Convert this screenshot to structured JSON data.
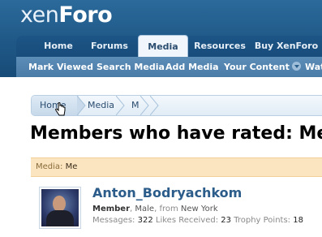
{
  "header": {
    "logo_a": "xen",
    "logo_b": "Foro"
  },
  "nav": {
    "tabs": [
      {
        "label": "Home"
      },
      {
        "label": "Forums"
      },
      {
        "label": "Media"
      },
      {
        "label": "Resources"
      },
      {
        "label": "Buy XenForo"
      }
    ],
    "selected_tab": "Media"
  },
  "subnav": {
    "items": [
      {
        "label": "Mark Viewed"
      },
      {
        "label": "Search Media"
      },
      {
        "label": "Add Media"
      },
      {
        "label": "Your Content"
      },
      {
        "label": "Wat"
      }
    ]
  },
  "breadcrumb": {
    "items": [
      {
        "label": "Home"
      },
      {
        "label": "Media"
      },
      {
        "label": "Me"
      }
    ]
  },
  "page": {
    "title": "Members who have rated: Me"
  },
  "info": {
    "label": "Media:",
    "value": "Me"
  },
  "member": {
    "name": "Anton_Bodryachkom",
    "title": "Member",
    "gender": "Male",
    "from_label": "from",
    "location": "New York",
    "messages_label": "Messages:",
    "messages": "322",
    "likes_label": "Likes Received:",
    "likes": "23",
    "points_label": "Trophy Points:",
    "points": "18"
  },
  "colors": {
    "header": "#1f5887",
    "subnav": "#4a7ca8",
    "infobar": "#fbe4c0",
    "link": "#2b5c8a"
  }
}
